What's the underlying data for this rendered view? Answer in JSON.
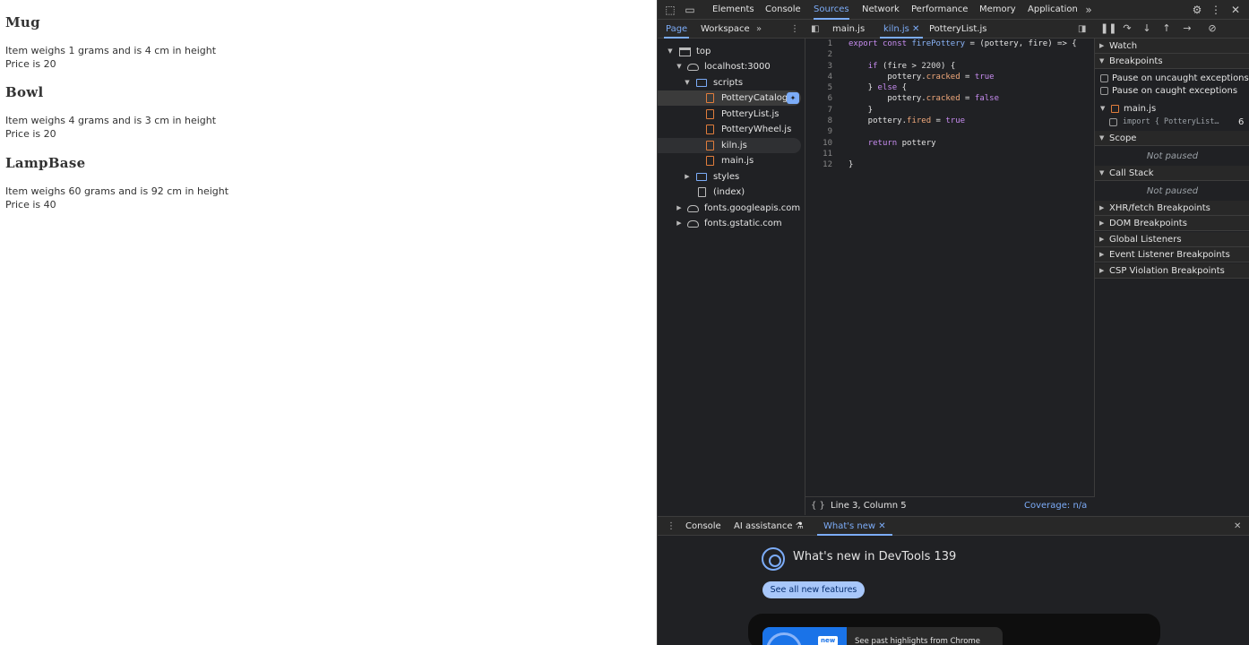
{
  "page": {
    "products": [
      {
        "name": "Mug",
        "desc": "Item weighs 1 grams and is 4 cm in height",
        "price": "Price is 20"
      },
      {
        "name": "Bowl",
        "desc": "Item weighs 4 grams and is 3 cm in height",
        "price": "Price is 20"
      },
      {
        "name": "LampBase",
        "desc": "Item weighs 60 grams and is 92 cm in height",
        "price": "Price is 40"
      }
    ]
  },
  "devtools": {
    "main_tabs": [
      "Elements",
      "Console",
      "Sources",
      "Network",
      "Performance",
      "Memory",
      "Application"
    ],
    "active_tab": "Sources",
    "navigator": {
      "tabs": [
        "Page",
        "Workspace"
      ],
      "tree": [
        {
          "label": "top",
          "type": "frame"
        },
        {
          "label": "localhost:3000",
          "type": "cloud"
        },
        {
          "label": "scripts",
          "type": "folder"
        },
        {
          "label": "PotteryCatalog.js",
          "type": "file"
        },
        {
          "label": "PotteryList.js",
          "type": "file"
        },
        {
          "label": "PotteryWheel.js",
          "type": "file"
        },
        {
          "label": "kiln.js",
          "type": "file"
        },
        {
          "label": "main.js",
          "type": "file"
        },
        {
          "label": "styles",
          "type": "folder"
        },
        {
          "label": "(index)",
          "type": "plain"
        },
        {
          "label": "fonts.googleapis.com",
          "type": "cloud"
        },
        {
          "label": "fonts.gstatic.com",
          "type": "cloud"
        }
      ]
    },
    "editor": {
      "tabs": [
        "main.js",
        "kiln.js",
        "PotteryList.js"
      ],
      "active_tab": "kiln.js",
      "line_numbers": [
        "1",
        "2",
        "3",
        "4",
        "5",
        "6",
        "7",
        "8",
        "9",
        "10",
        "11",
        "12"
      ],
      "status_position": "Line 3, Column 5",
      "coverage": "Coverage: n/a"
    },
    "sidebar": {
      "watch": "Watch",
      "breakpoints": "Breakpoints",
      "pause_uncaught": "Pause on uncaught exceptions",
      "pause_caught": "Pause on caught exceptions",
      "bp_file": "main.js",
      "bp_code": "import { PotteryList…",
      "bp_line": "6",
      "scope": "Scope",
      "not_paused": "Not paused",
      "call_stack": "Call Stack",
      "xhr": "XHR/fetch Breakpoints",
      "dom": "DOM Breakpoints",
      "global": "Global Listeners",
      "event": "Event Listener Breakpoints",
      "csp": "CSP Violation Breakpoints"
    },
    "drawer": {
      "tabs": [
        "Console",
        "AI assistance",
        "What's new"
      ],
      "active_tab": "What's new",
      "title": "What's new in DevTools 139",
      "button": "See all new features",
      "new_badge": "new",
      "highlights": "See past highlights from Chrome"
    },
    "colors": {
      "accent": "#7cacf8",
      "background": "#202124"
    }
  }
}
